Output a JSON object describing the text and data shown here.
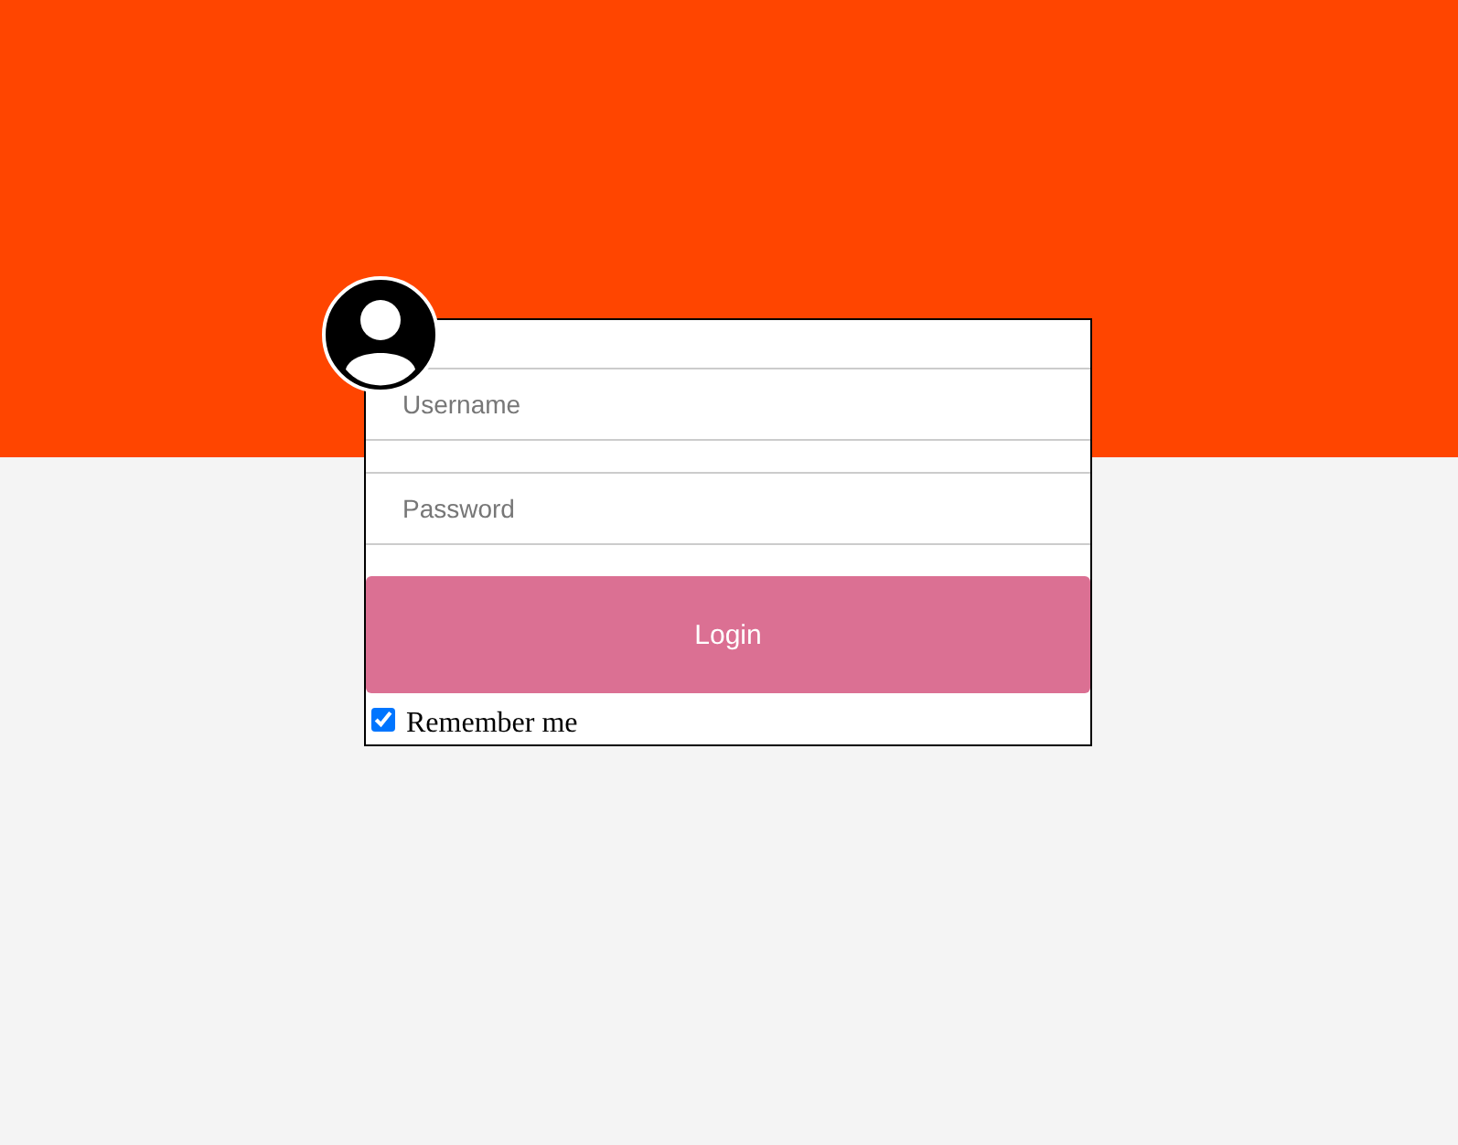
{
  "username": {
    "placeholder": "Username"
  },
  "password": {
    "placeholder": "Password"
  },
  "login_button": {
    "label": "Login"
  },
  "remember": {
    "label": "Remember me",
    "checked": true
  }
}
